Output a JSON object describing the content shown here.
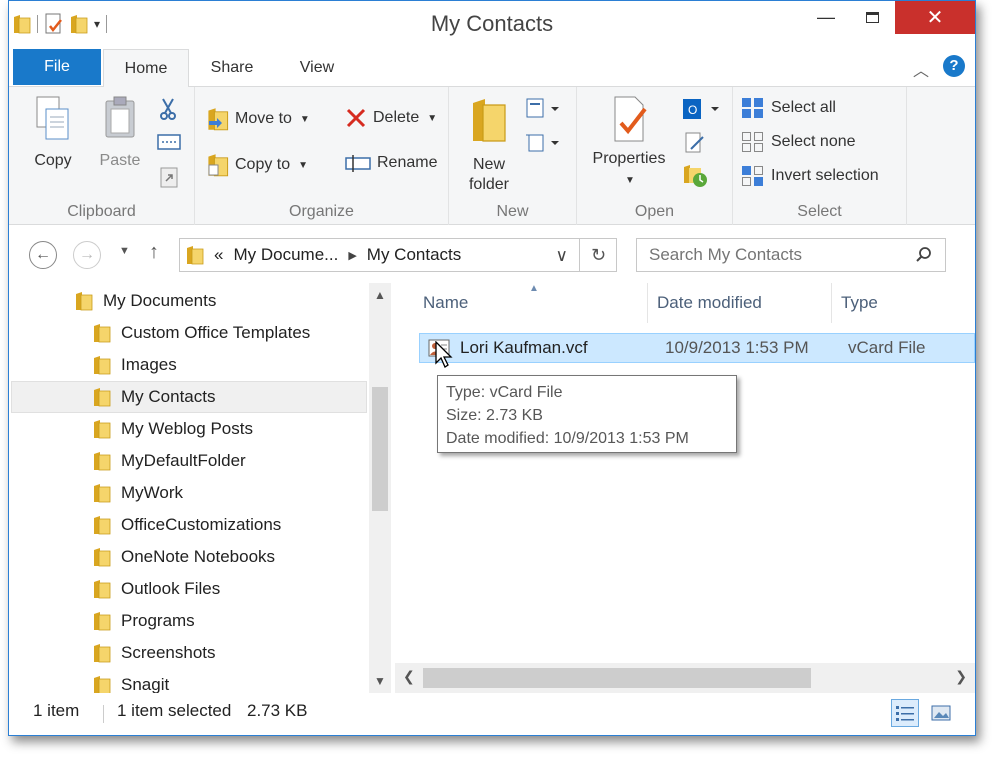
{
  "window": {
    "title": "My Contacts"
  },
  "ribbon_tabs": {
    "file": "File",
    "home": "Home",
    "share": "Share",
    "view": "View"
  },
  "clipboard": {
    "copy": "Copy",
    "paste": "Paste",
    "label": "Clipboard"
  },
  "organize": {
    "move_to": "Move to",
    "copy_to": "Copy to",
    "delete": "Delete",
    "rename": "Rename",
    "label": "Organize"
  },
  "new_group": {
    "new_folder_line1": "New",
    "new_folder_line2": "folder",
    "label": "New"
  },
  "open_group": {
    "properties": "Properties",
    "label": "Open"
  },
  "select_group": {
    "select_all": "Select all",
    "select_none": "Select none",
    "invert_selection": "Invert selection",
    "label": "Select"
  },
  "address": {
    "overflow": "«",
    "crumbs": [
      "My Docume...",
      "My Contacts"
    ]
  },
  "search": {
    "placeholder": "Search My Contacts"
  },
  "nav": {
    "root": "My Documents",
    "folders": [
      "Custom Office Templates",
      "Images",
      "My Contacts",
      "My Weblog Posts",
      "MyDefaultFolder",
      "MyWork",
      "OfficeCustomizations",
      "OneNote Notebooks",
      "Outlook Files",
      "Programs",
      "Screenshots",
      "Snagit"
    ],
    "selected": "My Contacts"
  },
  "columns": {
    "name": "Name",
    "date": "Date modified",
    "type": "Type"
  },
  "files": [
    {
      "name": "Lori Kaufman.vcf",
      "date": "10/9/2013 1:53 PM",
      "type": "vCard File"
    }
  ],
  "tooltip": {
    "type": "Type: vCard File",
    "size": "Size: 2.73 KB",
    "date": "Date modified: 10/9/2013 1:53 PM"
  },
  "status": {
    "count": "1 item",
    "selected": "1 item selected",
    "size": "2.73 KB"
  },
  "colors": {
    "accent": "#1979ca",
    "selection": "#cce8ff",
    "close": "#c9302c",
    "folder": "#e8c24a"
  }
}
